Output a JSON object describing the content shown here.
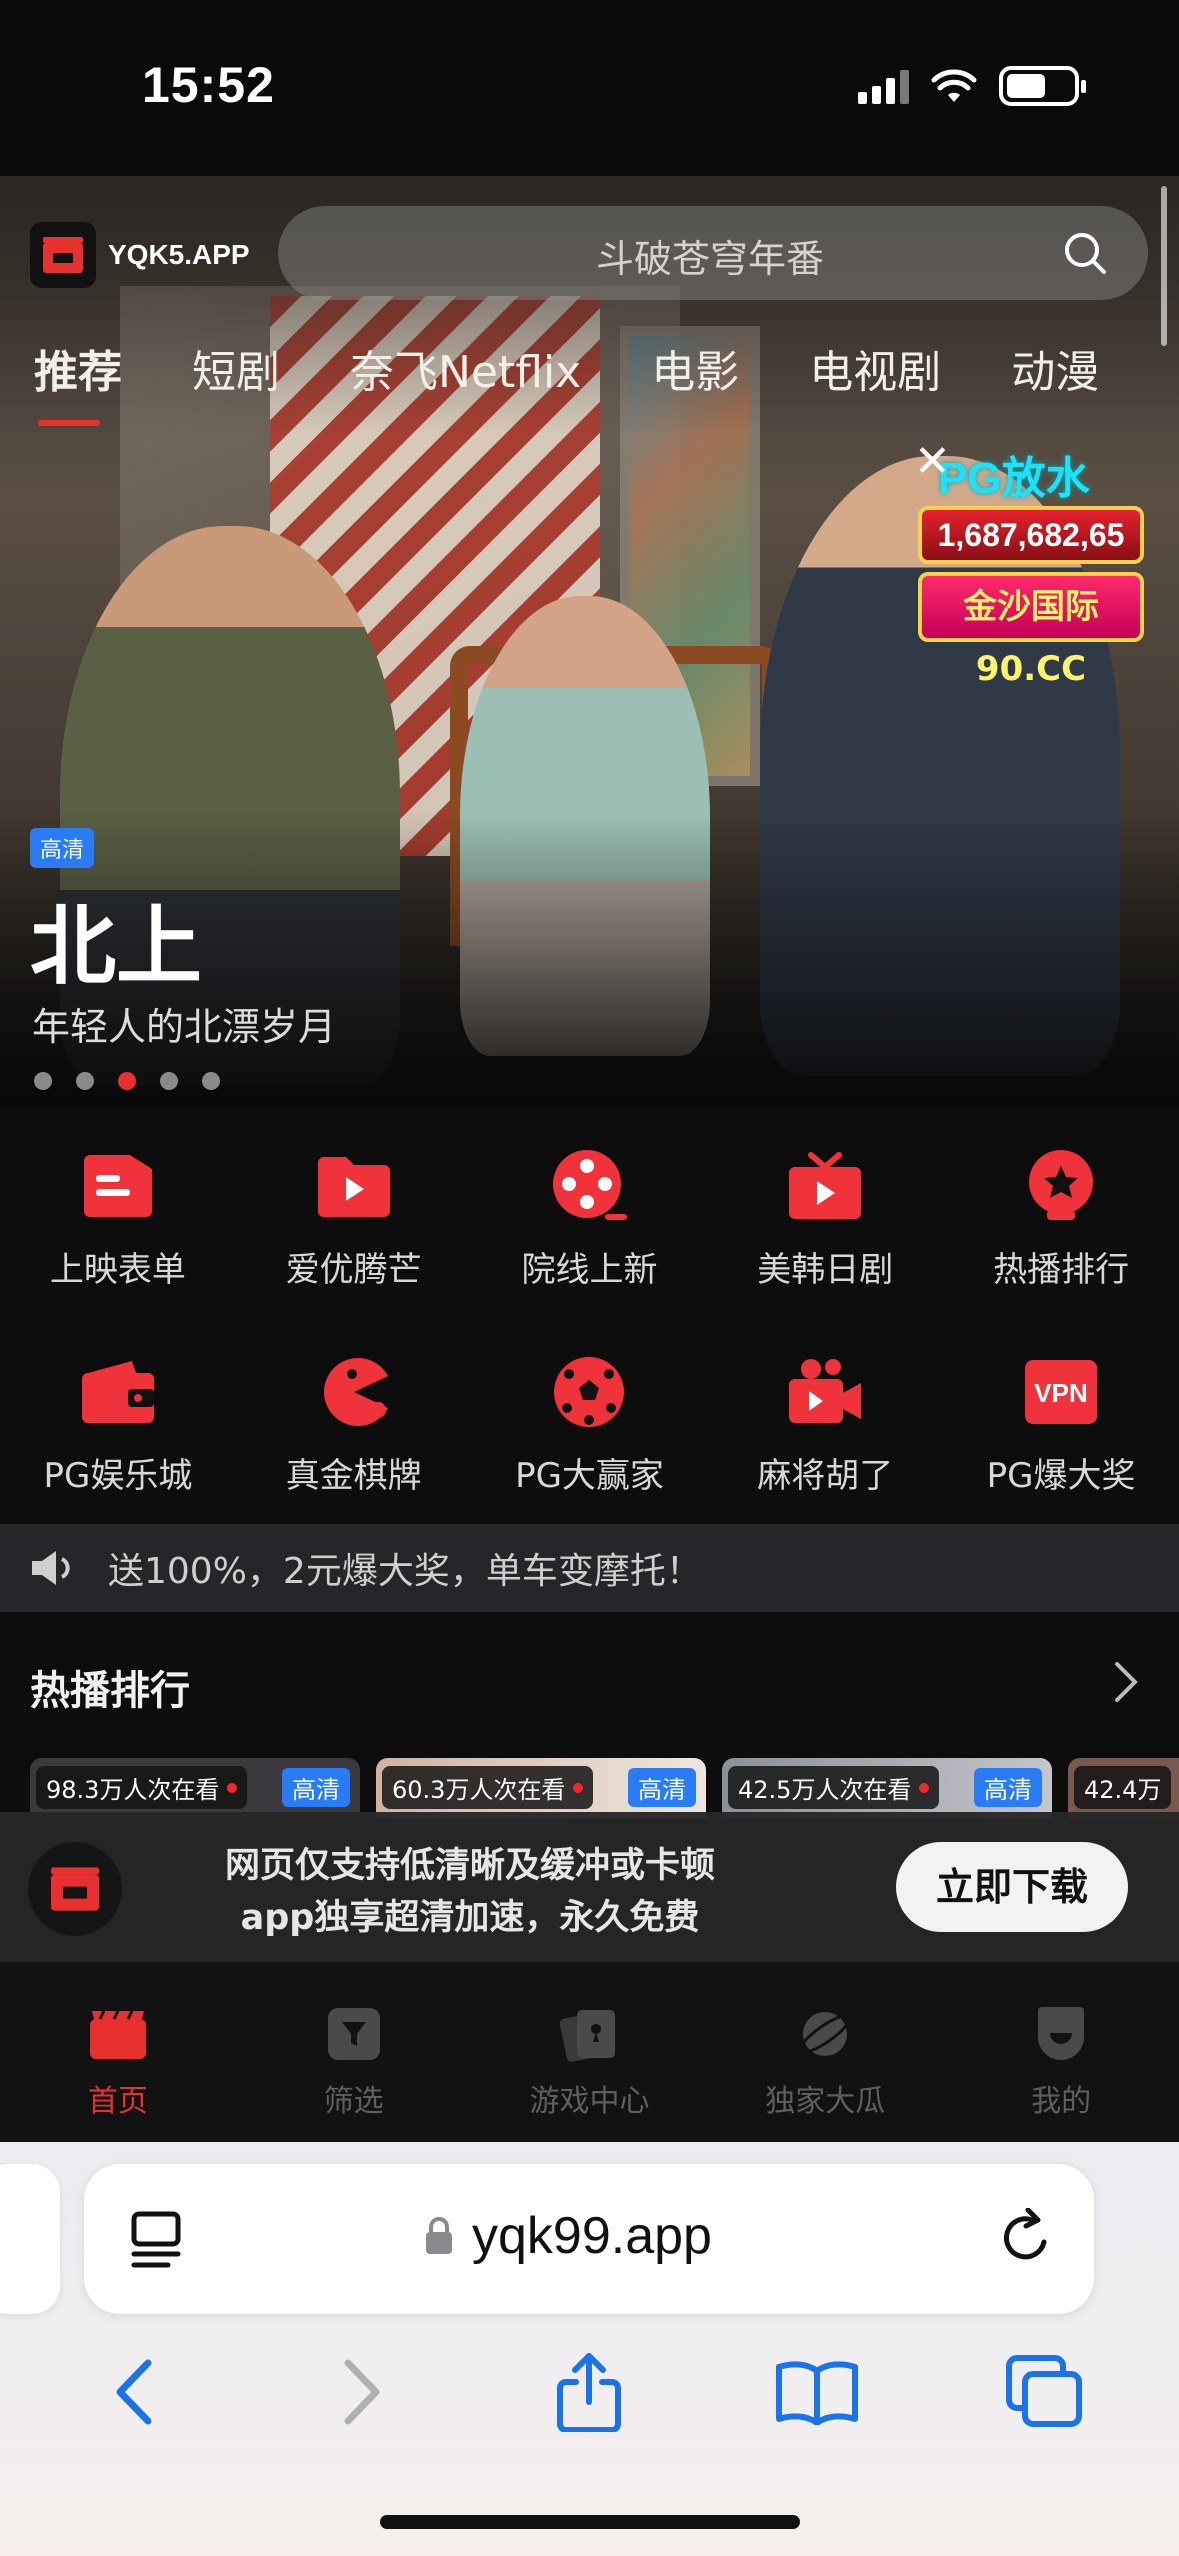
{
  "status_bar": {
    "time": "15:52"
  },
  "header": {
    "logo_text": "YQK5.APP",
    "search_placeholder": "斗破苍穹年番"
  },
  "tabs": [
    "推荐",
    "短剧",
    "奈飞Netflix",
    "电影",
    "电视剧",
    "动漫"
  ],
  "active_tab": "推荐",
  "ad": {
    "title": "PG放水",
    "amount": "1,687,682,65",
    "subtitle": "金沙国际90.CC",
    "close": "✕"
  },
  "hero": {
    "quality_tag": "高清",
    "title": "北上",
    "subtitle": "年轻人的北漂岁月",
    "slide_count": 5,
    "active_slide": 3
  },
  "categories": [
    {
      "label": "上映表单",
      "icon": "list-card-icon"
    },
    {
      "label": "爱优腾芒",
      "icon": "folder-play-icon"
    },
    {
      "label": "院线上新",
      "icon": "film-reel-icon"
    },
    {
      "label": "美韩日剧",
      "icon": "tv-play-icon"
    },
    {
      "label": "热播排行",
      "icon": "star-medal-icon"
    },
    {
      "label": "PG娱乐城",
      "icon": "wallet-icon"
    },
    {
      "label": "真金棋牌",
      "icon": "pacman-icon"
    },
    {
      "label": "PG大赢家",
      "icon": "soccer-ball-icon"
    },
    {
      "label": "麻将胡了",
      "icon": "video-camera-icon"
    },
    {
      "label": "PG爆大奖",
      "icon": "vpn-icon",
      "badge": "VPN"
    }
  ],
  "notice": {
    "text": "送100%，2元爆大奖，单车变摩托！"
  },
  "hot_section": {
    "title": "热播排行"
  },
  "cards": [
    {
      "watching": "98.3万人次在看",
      "quality": "高清"
    },
    {
      "watching": "60.3万人次在看",
      "quality": "高清"
    },
    {
      "watching": "42.5万人次在看",
      "quality": "高清"
    },
    {
      "watching": "42.4万",
      "quality": ""
    }
  ],
  "download_banner": {
    "line1": "网页仅支持低清晰及缓冲或卡顿",
    "line2": "app独享超清加速，永久免费",
    "button": "立即下载"
  },
  "tabbar": [
    {
      "label": "首页",
      "icon": "clapperboard-icon",
      "active": true
    },
    {
      "label": "筛选",
      "icon": "filter-icon",
      "active": false
    },
    {
      "label": "游戏中心",
      "icon": "cards-icon",
      "active": false
    },
    {
      "label": "独家大瓜",
      "icon": "planet-icon",
      "active": false
    },
    {
      "label": "我的",
      "icon": "profile-icon",
      "active": false
    }
  ],
  "browser": {
    "url": "yqk99.app"
  },
  "colors": {
    "accent": "#e8312f",
    "hd_blue": "#2a7bf6",
    "safari_blue": "#1a73e8"
  }
}
